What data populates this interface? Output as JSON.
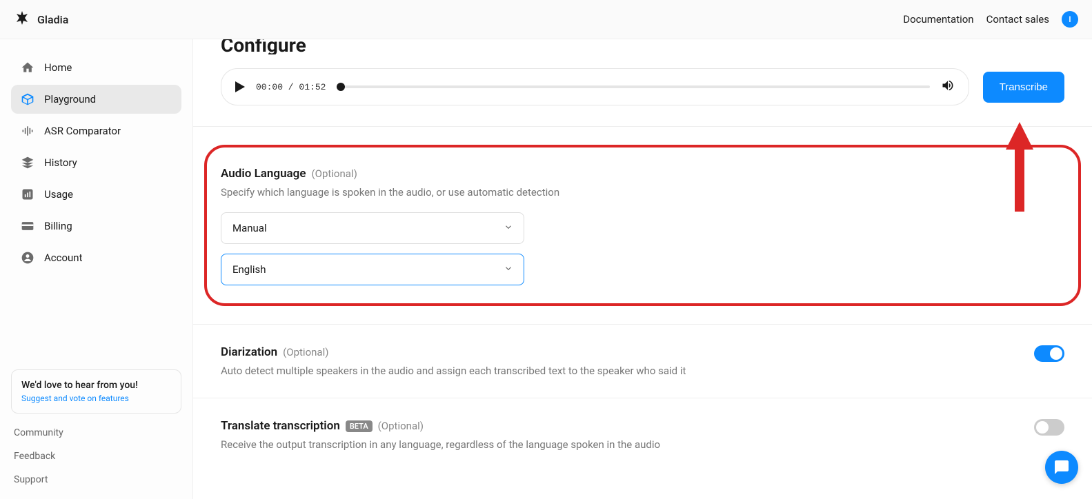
{
  "header": {
    "brand": "Gladia",
    "documentation": "Documentation",
    "contact_sales": "Contact sales",
    "avatar_initial": "I"
  },
  "sidebar": {
    "items": [
      {
        "label": "Home"
      },
      {
        "label": "Playground"
      },
      {
        "label": "ASR Comparator"
      },
      {
        "label": "History"
      },
      {
        "label": "Usage"
      },
      {
        "label": "Billing"
      },
      {
        "label": "Account"
      }
    ],
    "feedback": {
      "title": "We'd love to hear from you!",
      "link": "Suggest and vote on features"
    },
    "footer": {
      "community": "Community",
      "feedback": "Feedback",
      "support": "Support"
    }
  },
  "main": {
    "page_title": "Configure",
    "player": {
      "time": "00:00 / 01:52"
    },
    "transcribe_label": "Transcribe",
    "audio_language": {
      "title": "Audio Language",
      "optional": "(Optional)",
      "description": "Specify which language is spoken in the audio, or use automatic detection",
      "mode_value": "Manual",
      "language_value": "English"
    },
    "diarization": {
      "title": "Diarization",
      "optional": "(Optional)",
      "description": "Auto detect multiple speakers in the audio and assign each transcribed text to the speaker who said it",
      "enabled": true
    },
    "translate": {
      "title": "Translate transcription",
      "badge": "BETA",
      "optional": "(Optional)",
      "description": "Receive the output transcription in any language, regardless of the language spoken in the audio",
      "enabled": false
    }
  }
}
